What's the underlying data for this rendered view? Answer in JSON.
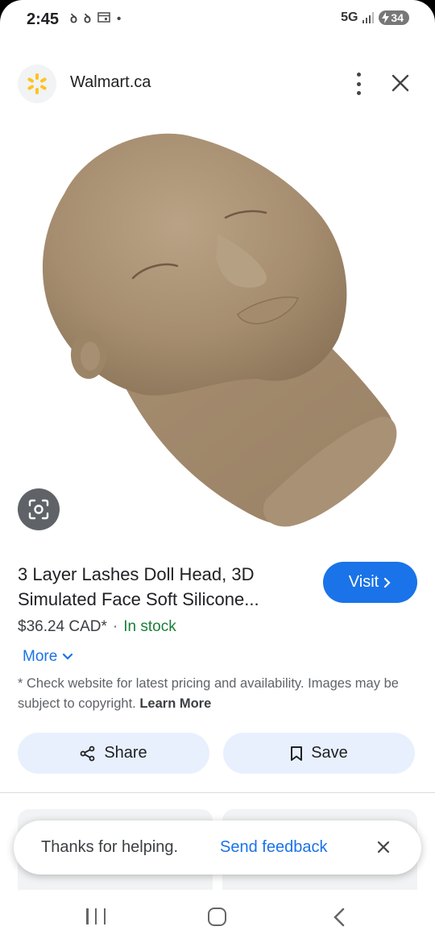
{
  "status_bar": {
    "time": "2:45",
    "icons": [
      "notification-icon",
      "notification-icon",
      "calendar-icon",
      "dot-icon"
    ],
    "network": "5G",
    "battery": "34"
  },
  "header": {
    "site_name": "Walmart.ca"
  },
  "product": {
    "title": "3 Layer Lashes Doll Head, 3D Simulated Face Soft Silicone...",
    "price": "$36.24 CAD*",
    "separator": "·",
    "stock": "In stock",
    "visit_label": "Visit",
    "more_label": "More",
    "disclaimer": "* Check website for latest pricing and availability. Images may be subject to copyright.",
    "learn_more": "Learn More"
  },
  "actions": {
    "share_label": "Share",
    "save_label": "Save"
  },
  "snackbar": {
    "text": "Thanks for helping.",
    "action": "Send feedback"
  },
  "colors": {
    "accent": "#1a73e8",
    "in_stock": "#188038",
    "chip_bg": "#e8f0fe",
    "walmart_yellow": "#ffc220"
  }
}
